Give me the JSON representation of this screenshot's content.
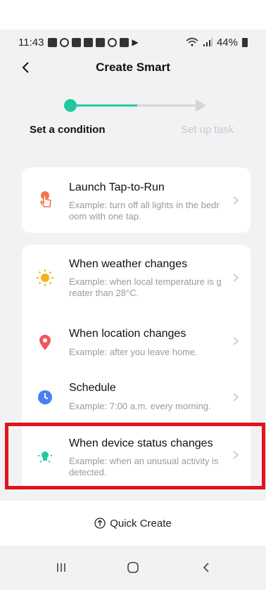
{
  "status_bar": {
    "time": "11:43",
    "battery": "44%"
  },
  "header": {
    "title": "Create Smart"
  },
  "steps": [
    {
      "label": "Set a condition",
      "active": true
    },
    {
      "label": "Set up task",
      "active": false
    }
  ],
  "colors": {
    "accent": "#1ec9a0",
    "highlight": "#e0151a",
    "tap_to_run_icon": "#f4734b",
    "weather_icon": "#f7b21b",
    "location_icon": "#f2555d",
    "schedule_icon": "#4a7ef5",
    "device_icon": "#1ec9a0"
  },
  "card1": {
    "items": [
      {
        "icon": "hand-tap-icon",
        "title": "Launch Tap-to-Run",
        "desc": "Example: turn off all lights in the bedr oom with one tap."
      }
    ]
  },
  "card2": {
    "items": [
      {
        "icon": "sun-icon",
        "title": "When weather changes",
        "desc": "Example: when local temperature is g reater than 28°C."
      },
      {
        "icon": "location-pin-icon",
        "title": "When location changes",
        "desc": "Example: after you leave home."
      },
      {
        "icon": "clock-icon",
        "title": "Schedule",
        "desc": "Example: 7:00 a.m. every morning."
      },
      {
        "icon": "device-status-icon",
        "title": "When device status changes",
        "desc": "Example: when an unusual activity is detected."
      }
    ]
  },
  "quick_create": {
    "label": "Quick Create"
  },
  "nav": {
    "recent": "recent-apps-icon",
    "home": "home-icon",
    "back": "back-icon"
  }
}
